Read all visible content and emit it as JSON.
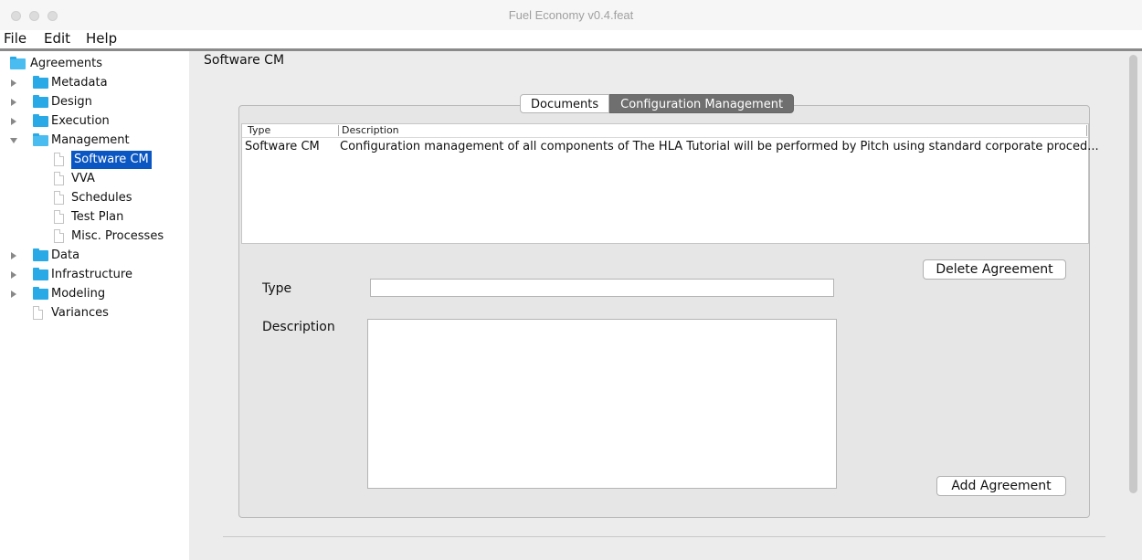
{
  "window": {
    "title": "Fuel Economy v0.4.feat"
  },
  "menu": {
    "file": "File",
    "edit": "Edit",
    "help": "Help"
  },
  "tree": {
    "root": "Agreements",
    "metadata": "Metadata",
    "design": "Design",
    "execution": "Execution",
    "management": "Management",
    "software_cm": "Software CM",
    "vva": "VVA",
    "schedules": "Schedules",
    "test_plan": "Test Plan",
    "misc_processes": "Misc. Processes",
    "data": "Data",
    "infrastructure": "Infrastructure",
    "modeling": "Modeling",
    "variances": "Variances"
  },
  "panel": {
    "header": "Software CM"
  },
  "tabs": {
    "documents": "Documents",
    "configuration_management": "Configuration Management"
  },
  "table": {
    "col_type": "Type",
    "col_description": "Description",
    "rows": [
      {
        "type": "Software CM",
        "description": "Configuration management of all components of The HLA Tutorial will be performed by Pitch using standard corporate proced..."
      }
    ]
  },
  "form": {
    "type_label": "Type",
    "type_value": "",
    "description_label": "Description",
    "description_value": ""
  },
  "buttons": {
    "delete": "Delete Agreement",
    "add": "Add Agreement"
  }
}
